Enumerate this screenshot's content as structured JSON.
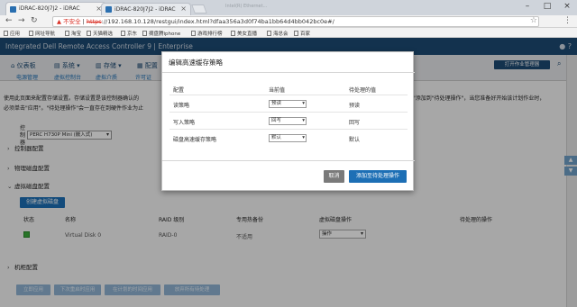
{
  "browser": {
    "active_tab_title": "iDRAC-820J7J2 - iDRAC",
    "second_tab_title": "iDRAC-820J7J2 - iDRAC",
    "window_title": "Intel(R) Ethernet...",
    "address_warning": "不安全",
    "address_strike": "https",
    "address_rest": "://192.168.10.128/restgui/index.html?dfaa356a3d0f74ba1bb64d4bb042bc0e#/",
    "bookmarks": [
      "应用",
      "网址导航",
      "淘宝",
      "天猫精选",
      "京东",
      "摘盘腾iphone",
      "游戏排行榜",
      "美女直播",
      "海总会",
      "百家"
    ]
  },
  "app": {
    "header_title": "Integrated Dell Remote Access Controller 9 | Enterprise",
    "nav": [
      "仪表板",
      "系统",
      "存储",
      "配置"
    ],
    "subnav": [
      "电源管理",
      "虚拟控制台",
      "虚拟介质",
      "许可证"
    ],
    "task_button": "打开作业管理器",
    "info_line1": "使用此页面来配置存储设置。存储设置是该控制器确认的",
    "info_line1_right": "\"添加到\"待处理操作\"，当您准备好开始该计划作业时，",
    "info_line2": "必须单击\"应用\"。\"待处理操作\"会一直存在到硬件作业为止",
    "ctrl_label_1": "控",
    "ctrl_label_2": "制",
    "ctrl_label_3": "器",
    "controller_select": "PERC H730P Mini (嵌入式)",
    "sections": {
      "controller": "控制器配置",
      "physical": "物理磁盘配置",
      "virtual": "虚拟磁盘配置",
      "enclosure": "机柜配置"
    },
    "create_vd_button": "创建虚拟磁盘",
    "table_headers": [
      "状态",
      "名称",
      "RAID 级别",
      "专用热备份",
      "虚拟磁盘操作",
      "待处理的操作"
    ],
    "table_row": {
      "name": "Virtual Disk 0",
      "raid": "RAID-0",
      "hotspare": "不适用",
      "operation": "操作"
    },
    "footer_buttons": [
      "立即应用",
      "下次重启时应用",
      "在计划的时间应用",
      "放弃所有待处理"
    ]
  },
  "modal": {
    "title": "编辑高速缓存策略",
    "headers": {
      "config": "配置",
      "current": "当前值",
      "pending": "待处理的值"
    },
    "rows": [
      {
        "label": "读策略",
        "current": "预读",
        "pending": "预读"
      },
      {
        "label": "写入策略",
        "current": "回写",
        "pending": "回写"
      },
      {
        "label": "磁盘高速缓存策略",
        "current": "默认",
        "pending": "默认"
      }
    ],
    "cancel_label": "取消",
    "add_label": "添加至待处理操作"
  },
  "colors": {
    "header_blue": "#1d4a73",
    "accent_blue": "#1d6fb5",
    "cancel_gray": "#7a7a7a",
    "status_green": "#3cab3c"
  }
}
